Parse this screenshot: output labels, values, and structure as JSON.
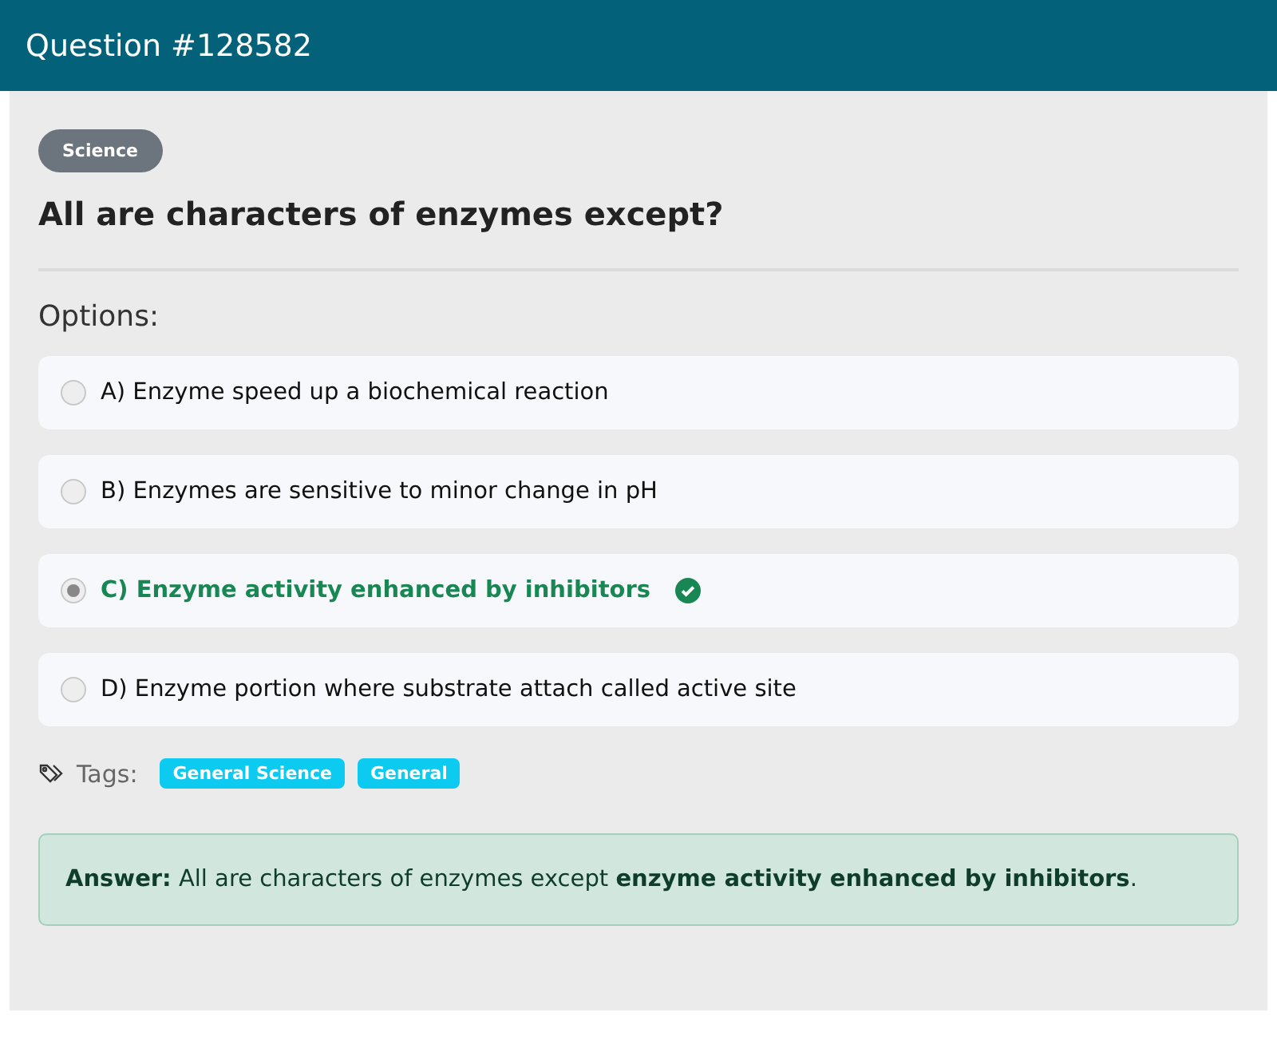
{
  "header": {
    "title": "Question #128582"
  },
  "category": "Science",
  "question": "All are characters of enzymes except?",
  "options_label": "Options:",
  "options": [
    {
      "text": "A) Enzyme speed up a biochemical reaction",
      "selected": false,
      "correct": false
    },
    {
      "text": "B) Enzymes are sensitive to minor change in pH",
      "selected": false,
      "correct": false
    },
    {
      "text": "C) Enzyme activity enhanced by inhibitors",
      "selected": true,
      "correct": true
    },
    {
      "text": "D) Enzyme portion where substrate attach called active site",
      "selected": false,
      "correct": false
    }
  ],
  "tags_label": "Tags:",
  "tags": [
    "General Science",
    "General"
  ],
  "answer": "**Answer:** All are characters of enzymes except **enzyme activity enhanced by inhibitors**."
}
